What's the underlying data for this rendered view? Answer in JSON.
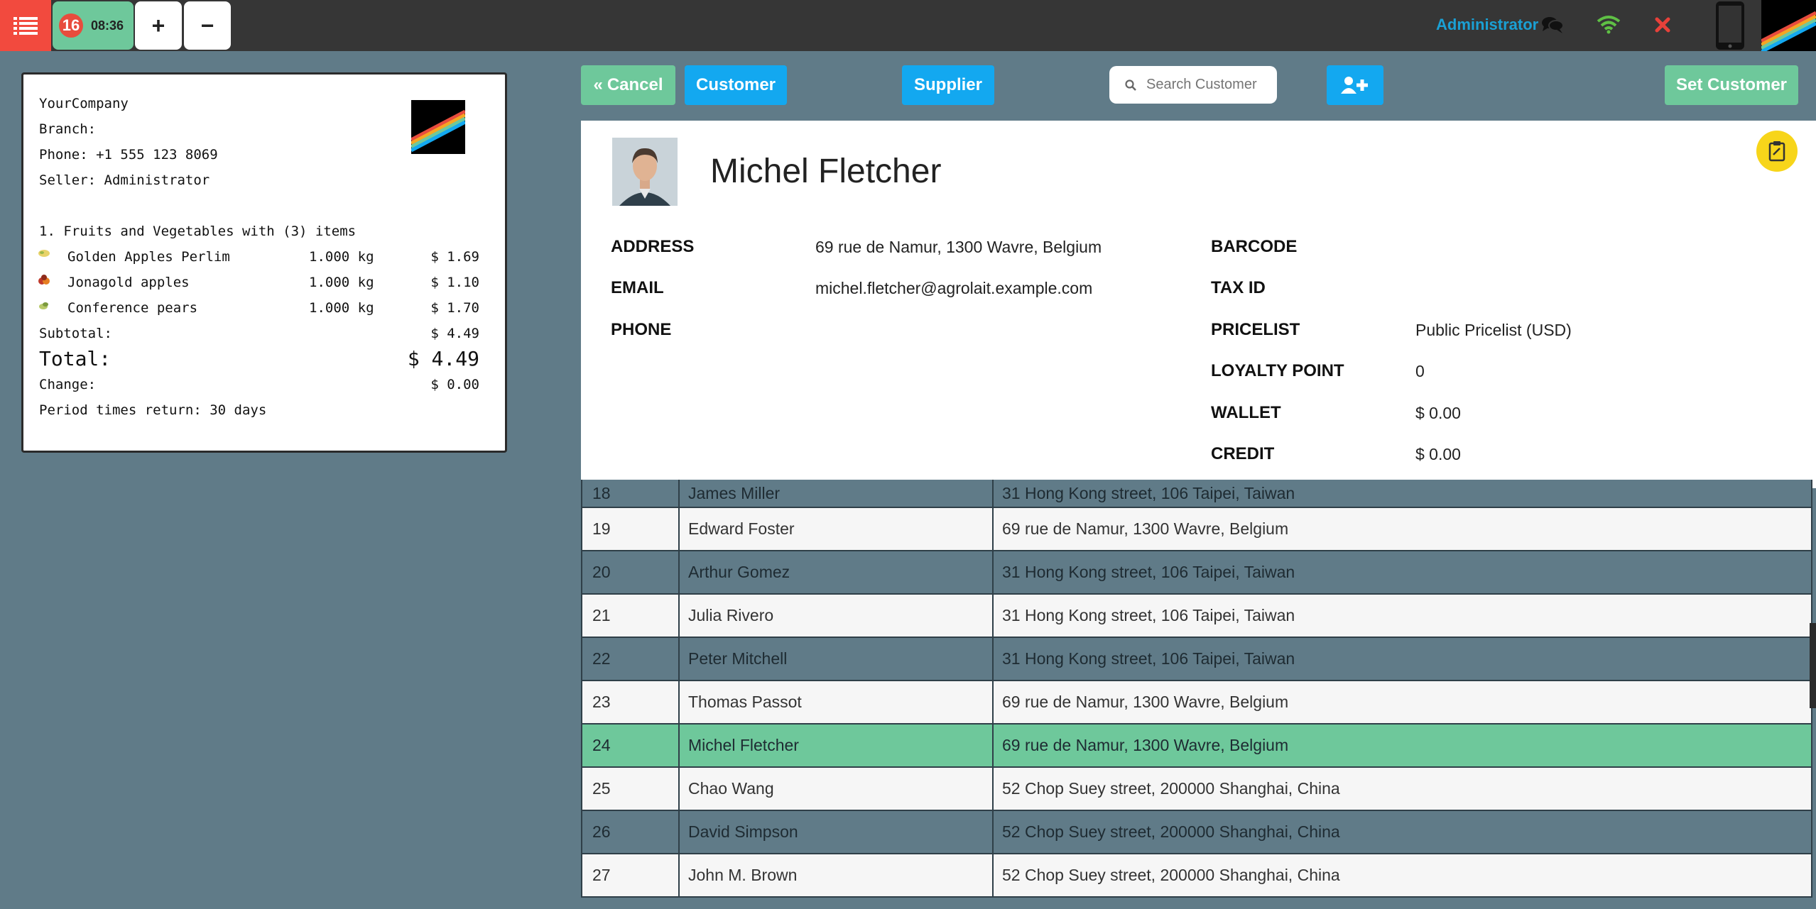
{
  "topbar": {
    "order_number": "16",
    "order_time": "08:36",
    "plus_label": "+",
    "minus_label": "−",
    "user_name": "Administrator"
  },
  "receipt": {
    "company": "YourCompany",
    "branch": "Branch:",
    "phone": "Phone: +1 555 123 8069",
    "seller": "Seller: Administrator",
    "category": "1. Fruits and Vegetables with (3) items",
    "items": [
      {
        "name": "Golden Apples Perlim",
        "qty": "1.000 kg",
        "price": "$ 1.69"
      },
      {
        "name": "Jonagold apples",
        "qty": "1.000 kg",
        "price": "$ 1.10"
      },
      {
        "name": "Conference pears",
        "qty": "1.000 kg",
        "price": "$ 1.70"
      }
    ],
    "subtotal_label": "Subtotal:",
    "subtotal_value": "$ 4.49",
    "total_label": "Total:",
    "total_value": "$ 4.49",
    "change_label": "Change:",
    "change_value": "$ 0.00",
    "return_period": "Period times return: 30 days"
  },
  "actions": {
    "cancel_label": "Cancel",
    "customer_label": "Customer",
    "supplier_label": "Supplier",
    "search_placeholder": "Search Customer",
    "set_customer_label": "Set Customer"
  },
  "customer": {
    "name": "Michel Fletcher",
    "address_label": "ADDRESS",
    "address": "69 rue de Namur, 1300 Wavre, Belgium",
    "email_label": "EMAIL",
    "email": "michel.fletcher@agrolait.example.com",
    "phone_label": "PHONE",
    "phone": "",
    "barcode_label": "BARCODE",
    "barcode": "",
    "taxid_label": "TAX ID",
    "taxid": "",
    "pricelist_label": "PRICELIST",
    "pricelist": "Public Pricelist (USD)",
    "loyalty_label": "LOYALTY POINT",
    "loyalty": "0",
    "wallet_label": "WALLET",
    "wallet": "$ 0.00",
    "credit_label": "CREDIT",
    "credit": "$ 0.00"
  },
  "customers": [
    {
      "id": "18",
      "name": "James Miller",
      "address": "31 Hong Kong street, 106 Taipei, Taiwan",
      "style": "dark"
    },
    {
      "id": "19",
      "name": "Edward Foster",
      "address": "69 rue de Namur, 1300 Wavre, Belgium",
      "style": "light"
    },
    {
      "id": "20",
      "name": "Arthur Gomez",
      "address": "31 Hong Kong street, 106 Taipei, Taiwan",
      "style": "dark"
    },
    {
      "id": "21",
      "name": "Julia Rivero",
      "address": "31 Hong Kong street, 106 Taipei, Taiwan",
      "style": "light"
    },
    {
      "id": "22",
      "name": "Peter Mitchell",
      "address": "31 Hong Kong street, 106 Taipei, Taiwan",
      "style": "dark"
    },
    {
      "id": "23",
      "name": "Thomas Passot",
      "address": "69 rue de Namur, 1300 Wavre, Belgium",
      "style": "light"
    },
    {
      "id": "24",
      "name": "Michel Fletcher",
      "address": "69 rue de Namur, 1300 Wavre, Belgium",
      "style": "sel"
    },
    {
      "id": "25",
      "name": "Chao Wang",
      "address": "52 Chop Suey street, 200000 Shanghai, China",
      "style": "light"
    },
    {
      "id": "26",
      "name": "David Simpson",
      "address": "52 Chop Suey street, 200000 Shanghai, China",
      "style": "dark"
    },
    {
      "id": "27",
      "name": "John M. Brown",
      "address": "52 Chop Suey street, 200000 Shanghai, China",
      "style": "light"
    }
  ],
  "colors": {
    "accent_green": "#6ec89b",
    "accent_blue": "#13a8f0",
    "danger_red": "#f24a3e",
    "background": "#607b88"
  }
}
